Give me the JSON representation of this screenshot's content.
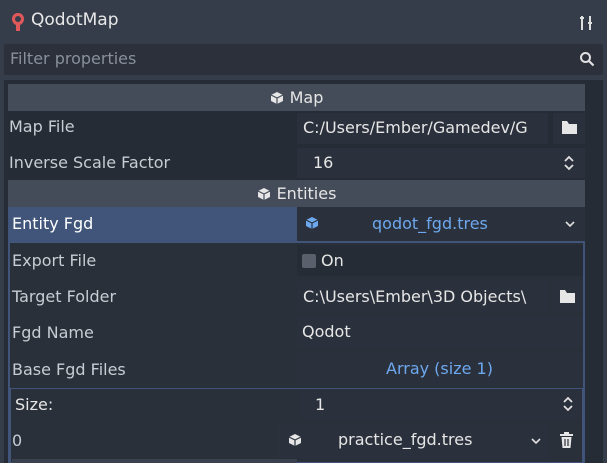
{
  "header": {
    "title": "QodotMap",
    "logo_icon": "godot-qodot-icon",
    "tools_icon": "tools-icon"
  },
  "filter": {
    "placeholder": "Filter properties"
  },
  "sections": {
    "map": "Map",
    "entities": "Entities"
  },
  "properties": {
    "map_file": {
      "label": "Map File",
      "value": "C:/Users/Ember/Gamedev/G"
    },
    "inverse_scale": {
      "label": "Inverse Scale Factor",
      "value": "16"
    },
    "entity_fgd": {
      "label": "Entity Fgd",
      "value": "qodot_fgd.tres"
    },
    "export_file": {
      "label": "Export File",
      "value": "On"
    },
    "target_folder": {
      "label": "Target Folder",
      "value": "C:\\Users\\Ember\\3D Objects\\"
    },
    "fgd_name": {
      "label": "Fgd Name",
      "value": "Qodot"
    },
    "base_fgd_files": {
      "label": "Base Fgd Files",
      "value": "Array (size 1)"
    },
    "size": {
      "label": "Size:",
      "value": "1"
    },
    "item0": {
      "index": "0",
      "value": "practice_fgd.tres"
    }
  },
  "colors": {
    "accent_blue": "#6da8ef",
    "selection": "#41557a",
    "section_bg": "#454c59",
    "panel_bg": "#262c36"
  }
}
